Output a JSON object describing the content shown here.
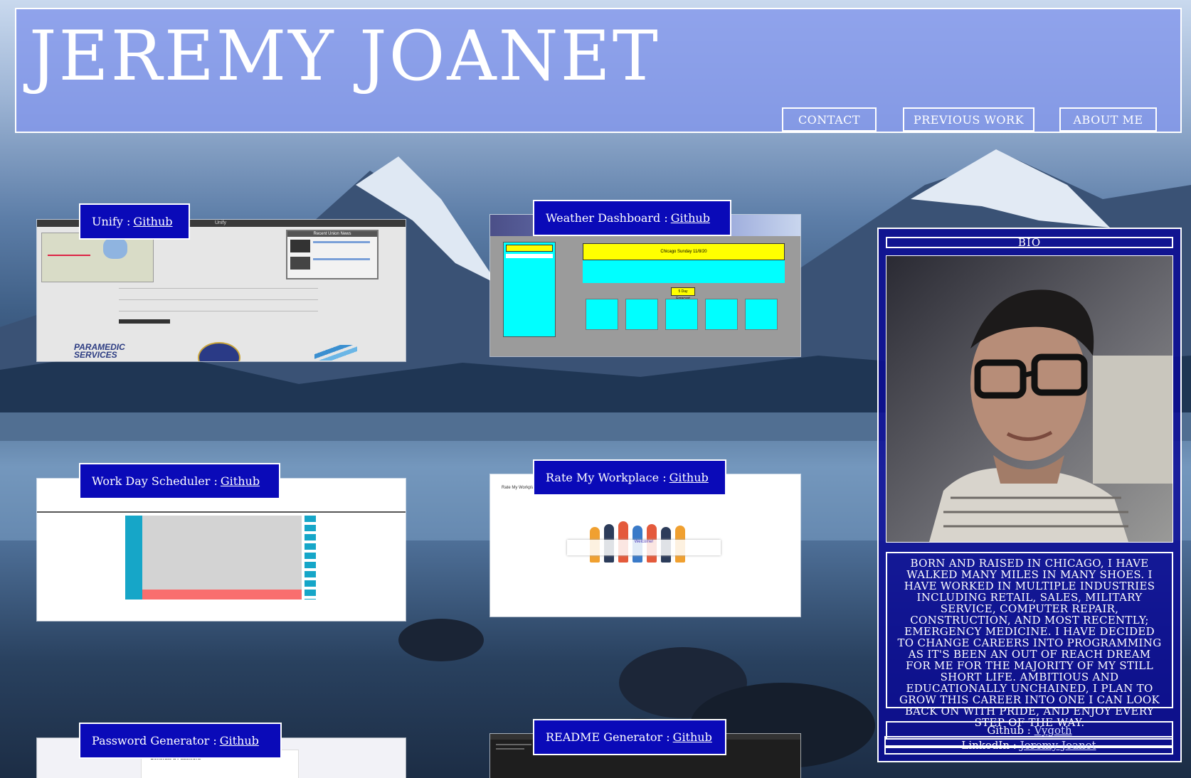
{
  "header": {
    "title": "JEREMY JOANET",
    "nav": {
      "contact": "CONTACT",
      "previous_work": "PREVIOUS WORK",
      "about_me": "ABOUT ME"
    }
  },
  "projects": [
    {
      "name": "Unify :",
      "link": "Github"
    },
    {
      "name": "Weather Dashboard :",
      "link": "Github"
    },
    {
      "name": "Work Day Scheduler :",
      "link": "Github"
    },
    {
      "name": "Rate My Workplace :",
      "link": "Github"
    },
    {
      "name": "Password Generator :",
      "link": "Github"
    },
    {
      "name": "README Generator :",
      "link": "Github"
    }
  ],
  "screenshots": {
    "unify": {
      "app_title": "Unify",
      "panel_title": "Recent Union News",
      "logo_text_1": "PARAMEDIC",
      "logo_text_2": "SERVICES"
    },
    "weather": {
      "header_text": "Chicago Sunday 11/8/20",
      "forecast_label": "5 Day Forecast"
    },
    "rate": {
      "brand": "Rate My Workplace",
      "welcome": "Welcome!"
    },
    "password": {
      "heading": "Generate a Password"
    }
  },
  "bio": {
    "heading": "BIO",
    "text": "Born and raised in Chicago, I have walked many miles in many shoes. I have worked in multiple industries including retail, sales, military service, computer repair, construction, and most recently; emergency medicine. I have decided to change careers into programming as it's been an out of reach dream for me for the majority of my still short life. Ambitious and educationally unchained, I plan to grow this career into one I can look back on with pride, and enjoy every step of the way.",
    "github_label": "Github :",
    "github_value": "Vygoth",
    "linkedin_label": "LinkedIn :",
    "linkedin_value": "Jeremy Joanet"
  },
  "colors": {
    "tag_bg": "#0a0ab8",
    "header_bg": "#8296eb",
    "weather_cyan": "#00ffff",
    "weather_yellow": "#ffff00",
    "scheduler_red": "#f96e6e"
  }
}
